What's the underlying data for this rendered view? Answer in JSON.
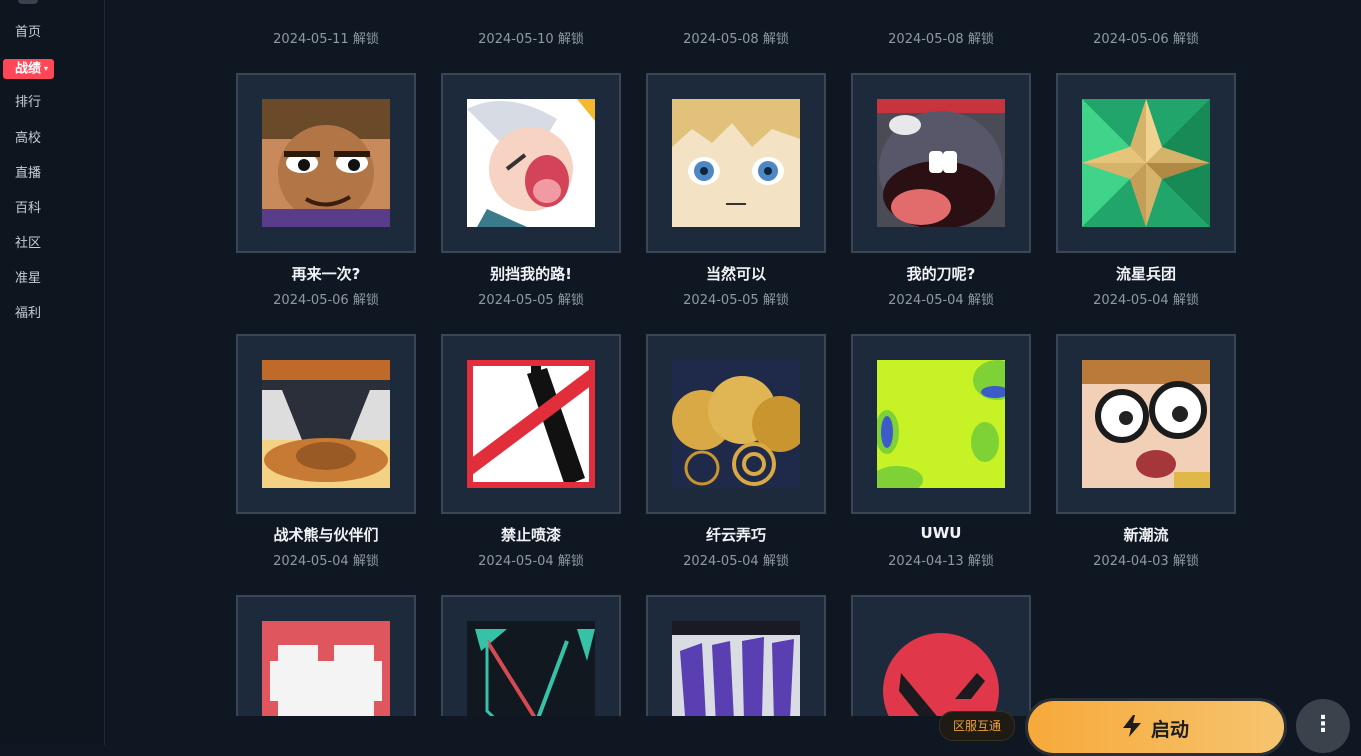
{
  "sidebar": {
    "items": [
      {
        "label": "首页"
      },
      {
        "label": "战绩",
        "caret": "▾"
      },
      {
        "label": "排行"
      },
      {
        "label": "高校"
      },
      {
        "label": "直播"
      },
      {
        "label": "百科"
      },
      {
        "label": "社区"
      },
      {
        "label": "准星"
      },
      {
        "label": "福利"
      }
    ]
  },
  "top_row_dates": [
    "2024-05-11 解锁",
    "2024-05-10 解锁",
    "2024-05-08 解锁",
    "2024-05-08 解锁",
    "2024-05-06 解锁"
  ],
  "cards": [
    {
      "title": "再来一次?",
      "date": "2024-05-06 解锁"
    },
    {
      "title": "别挡我的路!",
      "date": "2024-05-05 解锁"
    },
    {
      "title": "当然可以",
      "date": "2024-05-05 解锁"
    },
    {
      "title": "我的刀呢?",
      "date": "2024-05-04 解锁"
    },
    {
      "title": "流星兵团",
      "date": "2024-05-04 解锁"
    },
    {
      "title": "战术熊与伙伴们",
      "date": "2024-05-04 解锁"
    },
    {
      "title": "禁止喷漆",
      "date": "2024-05-04 解锁"
    },
    {
      "title": "纤云弄巧",
      "date": "2024-05-04 解锁"
    },
    {
      "title": "UWU",
      "date": "2024-04-13 解锁"
    },
    {
      "title": "新潮流",
      "date": "2024-04-03 解锁"
    }
  ],
  "footer": {
    "region_badge": "区服互通",
    "launch_label": "启动",
    "more_icon": "⋮"
  },
  "colors": {
    "background": "#0f1822",
    "accent_active": "#ff4757",
    "launch_gradient": [
      "#f7a93a",
      "#f6c46e"
    ]
  }
}
